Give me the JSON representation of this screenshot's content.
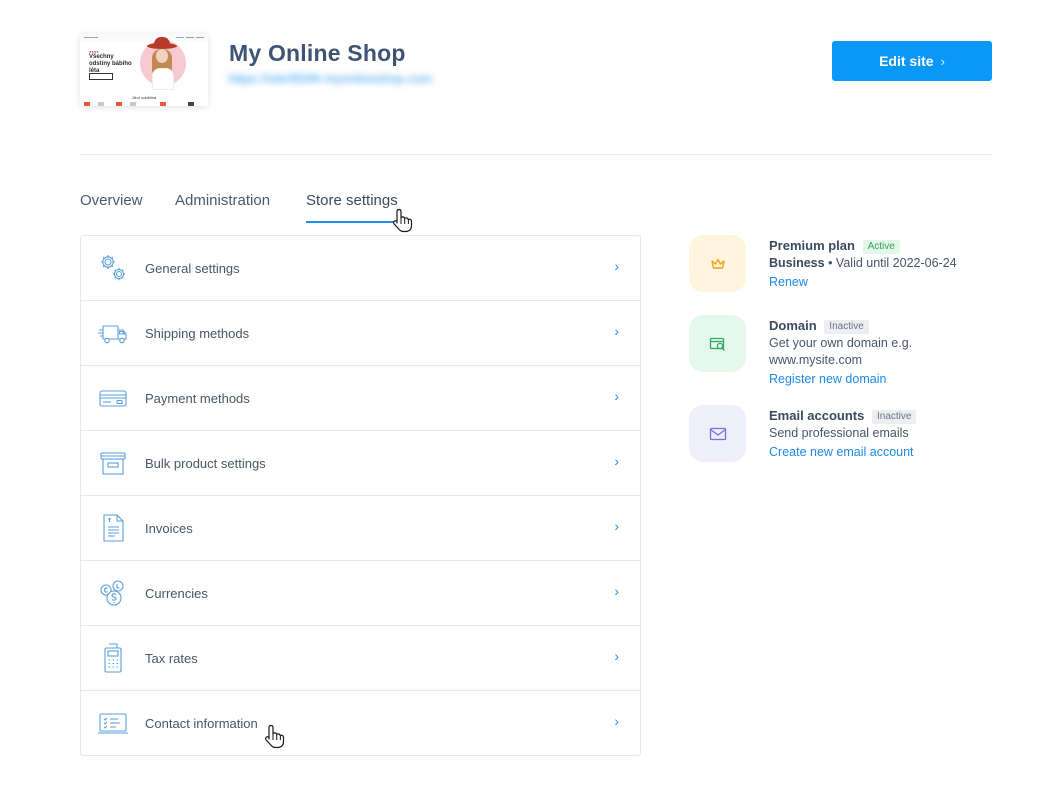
{
  "site": {
    "thumbnail": {
      "tagline": "Všechny odstíny bábího léta",
      "section": "Jižní oddělina"
    },
    "title": "My Online Shop",
    "url": "https://site/8599-myonlineshop.com"
  },
  "header": {
    "edit_button": "Edit site",
    "edit_chevron": "›"
  },
  "tabs": [
    {
      "label": "Overview",
      "active": false
    },
    {
      "label": "Administration",
      "active": false
    },
    {
      "label": "Store settings",
      "active": true
    }
  ],
  "settings": {
    "arrow": "›",
    "items": [
      {
        "label": "General settings",
        "icon": "gears-icon"
      },
      {
        "label": "Shipping methods",
        "icon": "delivery-truck-icon"
      },
      {
        "label": "Payment methods",
        "icon": "credit-card-icon"
      },
      {
        "label": "Bulk product settings",
        "icon": "archive-box-icon"
      },
      {
        "label": "Invoices",
        "icon": "invoice-document-icon"
      },
      {
        "label": "Currencies",
        "icon": "currency-coins-icon"
      },
      {
        "label": "Tax rates",
        "icon": "calculator-receipt-icon"
      },
      {
        "label": "Contact information",
        "icon": "contact-card-icon"
      }
    ]
  },
  "features": {
    "premium": {
      "title": "Premium plan",
      "status": "Active",
      "plan": "Business",
      "validity": "• Valid until 2022-06-24",
      "link": "Renew",
      "icon": "crown-icon",
      "color": "#fff4dd"
    },
    "domain": {
      "title": "Domain",
      "status": "Inactive",
      "description": "Get your own domain e.g. www.mysite.com",
      "link": "Register new domain",
      "icon": "domain-search-icon",
      "color": "#e6f7ee"
    },
    "email": {
      "title": "Email accounts",
      "status": "Inactive",
      "description": "Send professional emails",
      "link": "Create new email account",
      "icon": "envelope-icon",
      "color": "#efeefb"
    }
  },
  "colors": {
    "accent": "#0a97f5",
    "link": "#1e8ae6",
    "title": "#3f5474"
  }
}
